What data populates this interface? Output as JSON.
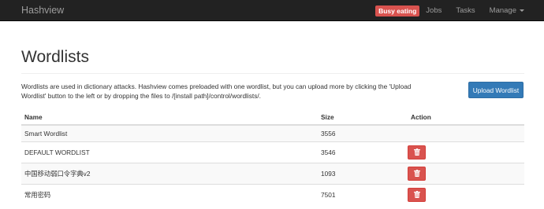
{
  "navbar": {
    "brand": "Hashview",
    "status_badge": "Busy eating",
    "links": [
      {
        "label": "Jobs"
      },
      {
        "label": "Tasks"
      },
      {
        "label": "Manage"
      }
    ]
  },
  "page": {
    "title": "Wordlists",
    "description": "Wordlists are used in dictionary attacks. Hashview comes preloaded with one wordlist, but you can upload more by clicking the 'Upload Wordlist' button to the left or by dropping the files to /[install path]/control/wordlists/.",
    "upload_button": "Upload Wordlist"
  },
  "table": {
    "headers": {
      "name": "Name",
      "size": "Size",
      "action": "Action"
    },
    "rows": [
      {
        "name": "Smart Wordlist",
        "size": "3556",
        "deletable": false
      },
      {
        "name": "DEFAULT WORDLIST",
        "size": "3546",
        "deletable": true
      },
      {
        "name": "中国移动弱口令字典v2",
        "size": "1093",
        "deletable": true
      },
      {
        "name": "常用密码",
        "size": "7501",
        "deletable": true
      }
    ]
  },
  "icons": {
    "delete": "trash-icon",
    "manage_dropdown": "caret-down-icon"
  },
  "colors": {
    "navbar": "#222222",
    "badge": "#d9534f",
    "primary": "#337ab7",
    "danger": "#d9534f"
  }
}
